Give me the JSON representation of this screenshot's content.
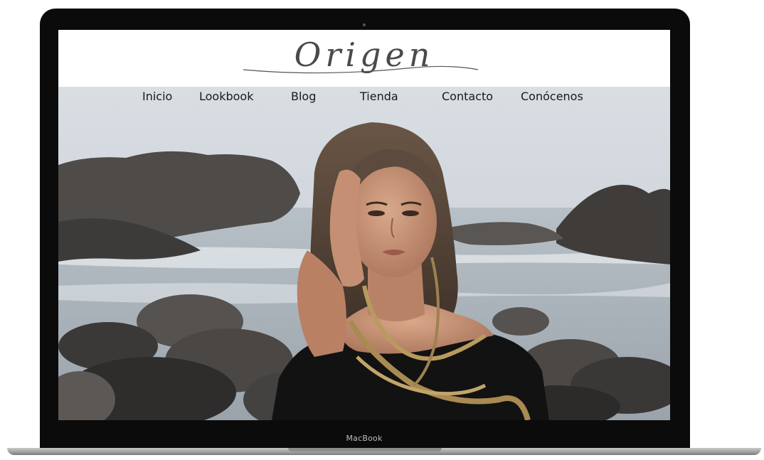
{
  "site": {
    "logo_text": "Origen"
  },
  "nav": {
    "items": [
      {
        "label": "Inicio"
      },
      {
        "label": "Lookbook"
      },
      {
        "label": "Blog"
      },
      {
        "label": "Tienda"
      },
      {
        "label": "Contacto"
      },
      {
        "label": "Conócenos"
      }
    ]
  },
  "device": {
    "brand_label": "MacBook"
  },
  "colors": {
    "header_bg": "#ffffff",
    "nav_text": "#1a1a1a",
    "logo_text": "#4a4a4a",
    "bezel": "#0b0b0b"
  }
}
